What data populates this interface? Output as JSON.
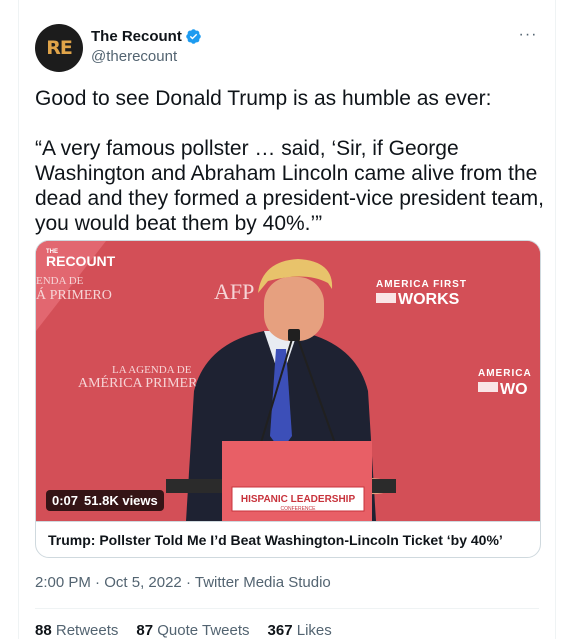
{
  "author": {
    "avatar_initials": "RE",
    "display_name": "The Recount",
    "handle": "@therecount"
  },
  "more_label": "···",
  "tweet": {
    "line1": "Good to see Donald Trump is as humble as ever:",
    "line2": "“A very famous pollster … said, ‘Sir, if George Washington and Abraham Lincoln came alive from the dead and they formed a president-vice president team, you would beat them by 40%.’”"
  },
  "media": {
    "brand_small": "THE",
    "brand": "RECOUNT",
    "banner_left_1": "ENDA DE",
    "banner_left_2": "Á PRIMERO",
    "banner_afp": "AFP",
    "banner_af_works_1": "AMERICA FIRST",
    "banner_af_works_2": "WORKS",
    "banner_agenda_1": "LA AGENDA DE",
    "banner_agenda_2": "AMÉRICA PRIMERO",
    "banner_right_1": "AMERICA",
    "banner_right_2": "WO",
    "podium_label": "HISPANIC LEADERSHIP",
    "podium_sub": "CONFERENCE",
    "time": "0:07",
    "views": "51.8K views",
    "caption": "Trump: Pollster Told Me I’d Beat Washington-Lincoln Ticket ‘by 40%’"
  },
  "meta": {
    "time": "2:00 PM",
    "date": "Oct 5, 2022",
    "source": "Twitter Media Studio"
  },
  "stats": {
    "retweets_count": "88",
    "retweets_label": "Retweets",
    "quotes_count": "87",
    "quotes_label": "Quote Tweets",
    "likes_count": "367",
    "likes_label": "Likes"
  },
  "colors": {
    "verified": "#1d9bf0",
    "video_bg": "#d9525a",
    "text_secondary": "#536471"
  },
  "icons": {
    "verified": "verified-badge-icon",
    "more": "more-horizontal-icon"
  }
}
